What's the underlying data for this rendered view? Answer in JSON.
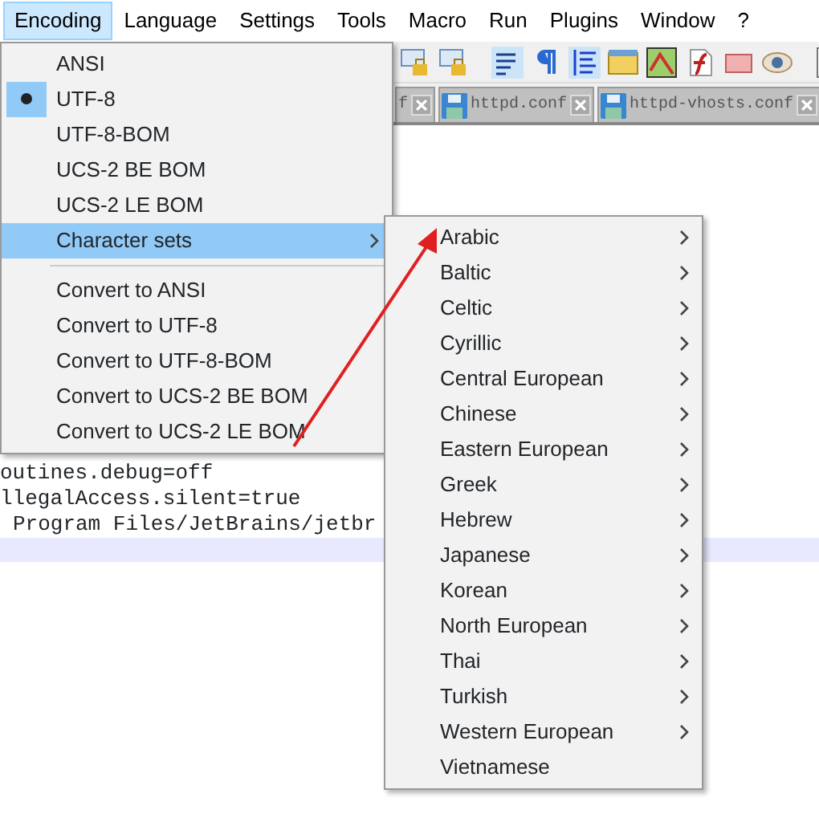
{
  "menubar": [
    {
      "label": "Encoding",
      "selected": true
    },
    {
      "label": "Language",
      "selected": false
    },
    {
      "label": "Settings",
      "selected": false
    },
    {
      "label": "Tools",
      "selected": false
    },
    {
      "label": "Macro",
      "selected": false
    },
    {
      "label": "Run",
      "selected": false
    },
    {
      "label": "Plugins",
      "selected": false
    },
    {
      "label": "Window",
      "selected": false
    },
    {
      "label": "?",
      "selected": false
    }
  ],
  "tabs": [
    {
      "label": "f",
      "saved_icon": false
    },
    {
      "label": "httpd.conf",
      "saved_icon": true
    },
    {
      "label": "httpd-vhosts.conf",
      "saved_icon": true
    }
  ],
  "editor": {
    "lines": [
      "outines.debug=off",
      "llegalAccess.silent=true",
      "Program Files/JetBrains/jetbr"
    ],
    "current_line_highlighted": true
  },
  "encoding_menu": [
    {
      "kind": "item",
      "label": "ANSI",
      "checked": false,
      "selected": false
    },
    {
      "kind": "item",
      "label": "UTF-8",
      "checked": true,
      "selected": false
    },
    {
      "kind": "item",
      "label": "UTF-8-BOM",
      "checked": false,
      "selected": false
    },
    {
      "kind": "item",
      "label": "UCS-2 BE BOM",
      "checked": false,
      "selected": false
    },
    {
      "kind": "item",
      "label": "UCS-2 LE BOM",
      "checked": false,
      "selected": false
    },
    {
      "kind": "submenu",
      "label": "Character sets",
      "checked": false,
      "selected": true
    },
    {
      "kind": "separator"
    },
    {
      "kind": "item",
      "label": "Convert to ANSI",
      "checked": false,
      "selected": false
    },
    {
      "kind": "item",
      "label": "Convert to UTF-8",
      "checked": false,
      "selected": false
    },
    {
      "kind": "item",
      "label": "Convert to UTF-8-BOM",
      "checked": false,
      "selected": false
    },
    {
      "kind": "item",
      "label": "Convert to UCS-2 BE BOM",
      "checked": false,
      "selected": false
    },
    {
      "kind": "item",
      "label": "Convert to UCS-2 LE BOM",
      "checked": false,
      "selected": false
    }
  ],
  "character_sets_menu": [
    {
      "label": "Arabic",
      "submenu": true
    },
    {
      "label": "Baltic",
      "submenu": true
    },
    {
      "label": "Celtic",
      "submenu": true
    },
    {
      "label": "Cyrillic",
      "submenu": true
    },
    {
      "label": "Central European",
      "submenu": true
    },
    {
      "label": "Chinese",
      "submenu": true
    },
    {
      "label": "Eastern European",
      "submenu": true
    },
    {
      "label": "Greek",
      "submenu": true
    },
    {
      "label": "Hebrew",
      "submenu": true
    },
    {
      "label": "Japanese",
      "submenu": true
    },
    {
      "label": "Korean",
      "submenu": true
    },
    {
      "label": "North European",
      "submenu": true
    },
    {
      "label": "Thai",
      "submenu": true
    },
    {
      "label": "Turkish",
      "submenu": true
    },
    {
      "label": "Western European",
      "submenu": true
    },
    {
      "label": "Vietnamese",
      "submenu": false
    }
  ]
}
